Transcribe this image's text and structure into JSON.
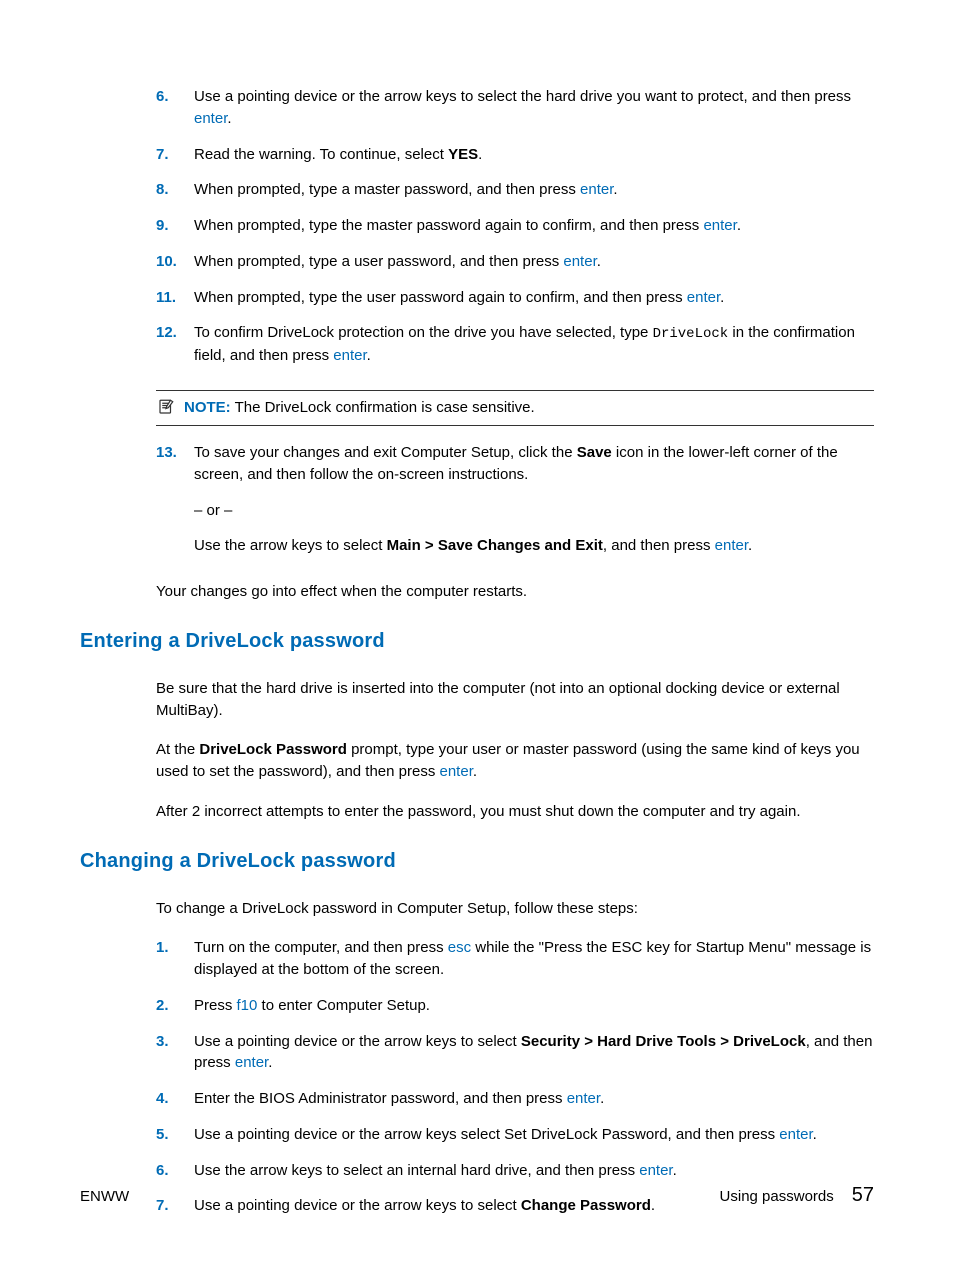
{
  "list1": {
    "s6": {
      "num": "6.",
      "pre": "Use a pointing device or the arrow keys to select the hard drive you want to protect, and then press ",
      "key": "enter",
      "post": "."
    },
    "s7": {
      "num": "7.",
      "pre": "Read the warning. To continue, select ",
      "bold": "YES",
      "post": "."
    },
    "s8": {
      "num": "8.",
      "pre": "When prompted, type a master password, and then press ",
      "key": "enter",
      "post": "."
    },
    "s9": {
      "num": "9.",
      "pre": "When prompted, type the master password again to confirm, and then press ",
      "key": "enter",
      "post": "."
    },
    "s10": {
      "num": "10.",
      "pre": "When prompted, type a user password, and then press ",
      "key": "enter",
      "post": "."
    },
    "s11": {
      "num": "11.",
      "pre": "When prompted, type the user password again to confirm, and then press ",
      "key": "enter",
      "post": "."
    },
    "s12": {
      "num": "12.",
      "pre": "To confirm DriveLock protection on the drive you have selected, type ",
      "mono": "DriveLock",
      "mid": " in the confirmation field, and then press ",
      "key": "enter",
      "post": "."
    },
    "note": {
      "label": "NOTE:",
      "text": "   The DriveLock confirmation is case sensitive."
    },
    "s13": {
      "num": "13.",
      "line1a": "To save your changes and exit Computer Setup, click the ",
      "bold1": "Save",
      "line1b": " icon in the lower-left corner of the screen, and then follow the on-screen instructions.",
      "or": "– or –",
      "line2a": "Use the arrow keys to select ",
      "bold2": "Main > Save Changes and Exit",
      "line2b": ", and then press ",
      "key": "enter",
      "post": "."
    }
  },
  "after1": "Your changes go into effect when the computer restarts.",
  "h_enter": "Entering a DriveLock password",
  "enter_p1": "Be sure that the hard drive is inserted into the computer (not into an optional docking device or external MultiBay).",
  "enter_p2a": "At the ",
  "enter_p2bold": "DriveLock Password",
  "enter_p2b": " prompt, type your user or master password (using the same kind of keys you used to set the password), and then press ",
  "enter_p2key": "enter",
  "enter_p2c": ".",
  "enter_p3": "After 2 incorrect attempts to enter the password, you must shut down the computer and try again.",
  "h_change": "Changing a DriveLock password",
  "change_intro": "To change a DriveLock password in Computer Setup, follow these steps:",
  "list2": {
    "s1": {
      "num": "1.",
      "pre": "Turn on the computer, and then press ",
      "key": "esc",
      "post": " while the \"Press the ESC key for Startup Menu\" message is displayed at the bottom of the screen."
    },
    "s2": {
      "num": "2.",
      "pre": "Press ",
      "key": "f10",
      "post": " to enter Computer Setup."
    },
    "s3": {
      "num": "3.",
      "pre": "Use a pointing device or the arrow keys to select ",
      "bold": "Security > Hard Drive Tools > DriveLock",
      "mid": ", and then press ",
      "key": "enter",
      "post": "."
    },
    "s4": {
      "num": "4.",
      "pre": "Enter the BIOS Administrator password, and then press ",
      "key": "enter",
      "post": "."
    },
    "s5": {
      "num": "5.",
      "pre": "Use a pointing device or the arrow keys select Set DriveLock Password, and then press ",
      "key": "enter",
      "post": "."
    },
    "s6": {
      "num": "6.",
      "pre": "Use the arrow keys to select an internal hard drive, and then press ",
      "key": "enter",
      "post": "."
    },
    "s7": {
      "num": "7.",
      "pre": "Use a pointing device or the arrow keys to select ",
      "bold": "Change Password",
      "post": "."
    }
  },
  "footer": {
    "left": "ENWW",
    "right": "Using passwords",
    "page": "57"
  }
}
